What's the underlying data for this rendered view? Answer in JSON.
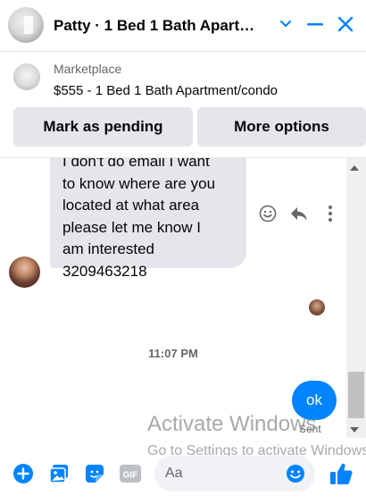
{
  "header": {
    "title": "Patty · 1 Bed 1 Bath Apart…",
    "icons": [
      "chevron-down-icon",
      "minimize-icon",
      "close-icon"
    ],
    "accent": "#0084ff"
  },
  "marketplace": {
    "label": "Marketplace",
    "listing": "$555 - 1 Bed 1 Bath Apartment/condo",
    "pending_button": "Mark as pending",
    "more_button": "More options"
  },
  "messages": {
    "incoming_text": "I don't do email I want\nto know where are you\nlocated at what area\nplease let me know I\nam interested\n3209463218",
    "reaction_icons": [
      "smile-icon",
      "reply-icon",
      "more-dots-icon"
    ],
    "timestamp": "11:07 PM",
    "outgoing_text": "ok",
    "status": "Sent"
  },
  "watermark": {
    "title": "Activate Windows",
    "subtitle": "Go to Settings to activate Windows."
  },
  "composer": {
    "placeholder": "Aa",
    "icons": [
      "plus-icon",
      "photo-icon",
      "sticker-icon",
      "gif-icon",
      "emoji-icon",
      "thumbs-up-icon"
    ],
    "gif_label": "GIF"
  }
}
